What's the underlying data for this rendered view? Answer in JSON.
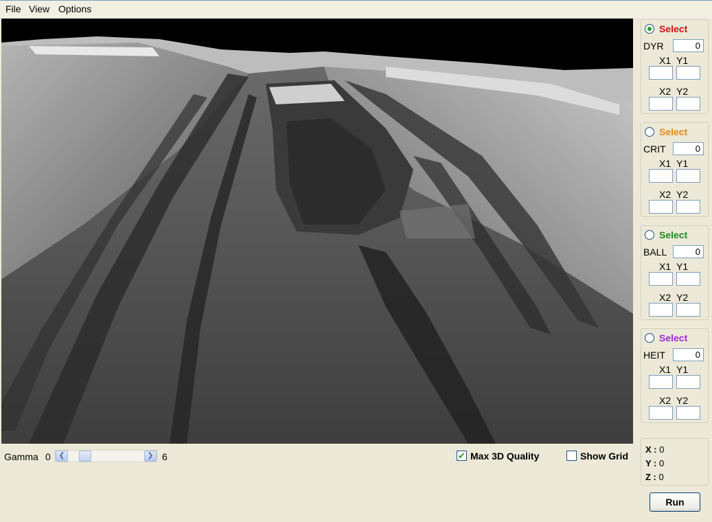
{
  "menu": [
    "File",
    "View",
    "Options"
  ],
  "panels": [
    {
      "select_label": "Select",
      "select_color": "#cc1111",
      "checked": true,
      "param_label": "DYR",
      "param_value": "0",
      "x1_label": "X1",
      "y1_label": "Y1",
      "x2_label": "X2",
      "y2_label": "Y2"
    },
    {
      "select_label": "Select",
      "select_color": "#e08a12",
      "checked": false,
      "param_label": "CRIT",
      "param_value": "0",
      "x1_label": "X1",
      "y1_label": "Y1",
      "x2_label": "X2",
      "y2_label": "Y2"
    },
    {
      "select_label": "Select",
      "select_color": "#1f8a1f",
      "checked": false,
      "param_label": "BALL",
      "param_value": "0",
      "x1_label": "X1",
      "y1_label": "Y1",
      "x2_label": "X2",
      "y2_label": "Y2"
    },
    {
      "select_label": "Select",
      "select_color": "#9a2bd6",
      "checked": false,
      "param_label": "HEIT",
      "param_value": "0",
      "x1_label": "X1",
      "y1_label": "Y1",
      "x2_label": "X2",
      "y2_label": "Y2"
    }
  ],
  "gamma": {
    "label": "Gamma",
    "min": "0",
    "max": "6",
    "value": 1
  },
  "max_quality": {
    "label": "Max 3D Quality",
    "checked": true
  },
  "show_grid": {
    "label": "Show Grid",
    "checked": false
  },
  "coords": {
    "x_label": "X :",
    "x": "0",
    "y_label": "Y :",
    "y": "0",
    "z_label": "Z :",
    "z": "0"
  },
  "run_label": "Run"
}
